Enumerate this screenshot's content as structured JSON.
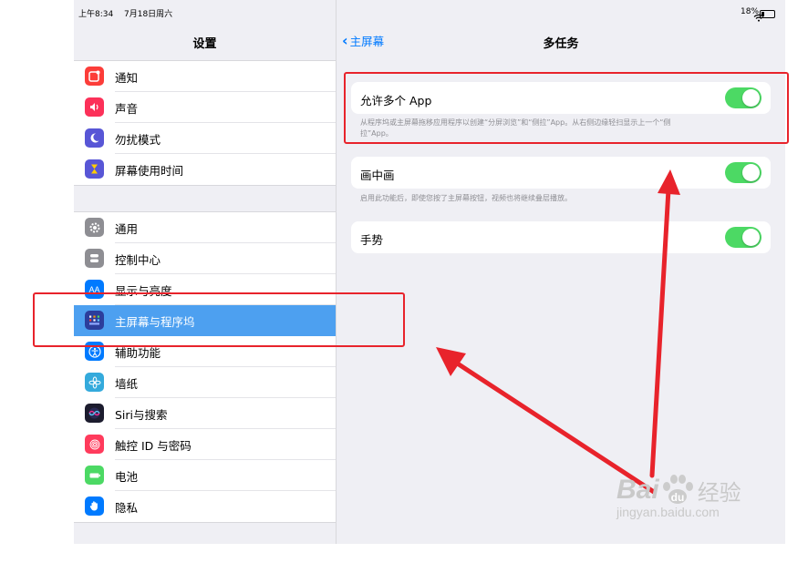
{
  "status_bar": {
    "time": "上午8:34",
    "date": "7月18日周六",
    "battery": "18%"
  },
  "sidebar": {
    "title": "设置",
    "group1": [
      {
        "label": "通知",
        "icon": "notifications-icon"
      },
      {
        "label": "声音",
        "icon": "sounds-icon"
      },
      {
        "label": "勿扰模式",
        "icon": "do-not-disturb-moon-icon"
      },
      {
        "label": "屏幕使用时间",
        "icon": "screen-time-hourglass-icon"
      }
    ],
    "group2": [
      {
        "label": "通用",
        "icon": "general-gear-icon"
      },
      {
        "label": "控制中心",
        "icon": "control-center-icon"
      },
      {
        "label": "显示与亮度",
        "icon": "display-brightness-icon"
      },
      {
        "label": "主屏幕与程序坞",
        "icon": "home-screen-dock-icon",
        "selected": true
      },
      {
        "label": "辅助功能",
        "icon": "accessibility-icon"
      },
      {
        "label": "墙纸",
        "icon": "wallpaper-flower-icon"
      },
      {
        "label": "Siri与搜索",
        "icon": "siri-icon"
      },
      {
        "label": "触控 ID 与密码",
        "icon": "touch-id-fingerprint-icon"
      },
      {
        "label": "电池",
        "icon": "battery-icon"
      },
      {
        "label": "隐私",
        "icon": "privacy-hand-icon"
      }
    ]
  },
  "detail": {
    "back_label": "主屏幕",
    "title": "多任务",
    "allow_multiple_apps": {
      "label": "允许多个 App",
      "on": true,
      "footer_line1": "从程序坞或主屏幕拖移应用程序以创建“分屏浏览”和“侧拉”App。从右侧边缘轻扫显示上一个“侧",
      "footer_line2": "拉”App。"
    },
    "picture_in_picture": {
      "label": "画中画",
      "on": true,
      "footer": "启用此功能后，即使您按了主屏幕按钮，视频也将继续叠层播放。"
    },
    "gestures": {
      "label": "手势",
      "on": true
    }
  },
  "watermark": {
    "brand": "Bai",
    "brand_suffix": "经验",
    "url": "jingyan.baidu.com"
  },
  "colors": {
    "accent": "#4da0f0",
    "toggle_on": "#4cd964",
    "annotation_red": "#e8232b",
    "ios_blue": "#007aff"
  }
}
